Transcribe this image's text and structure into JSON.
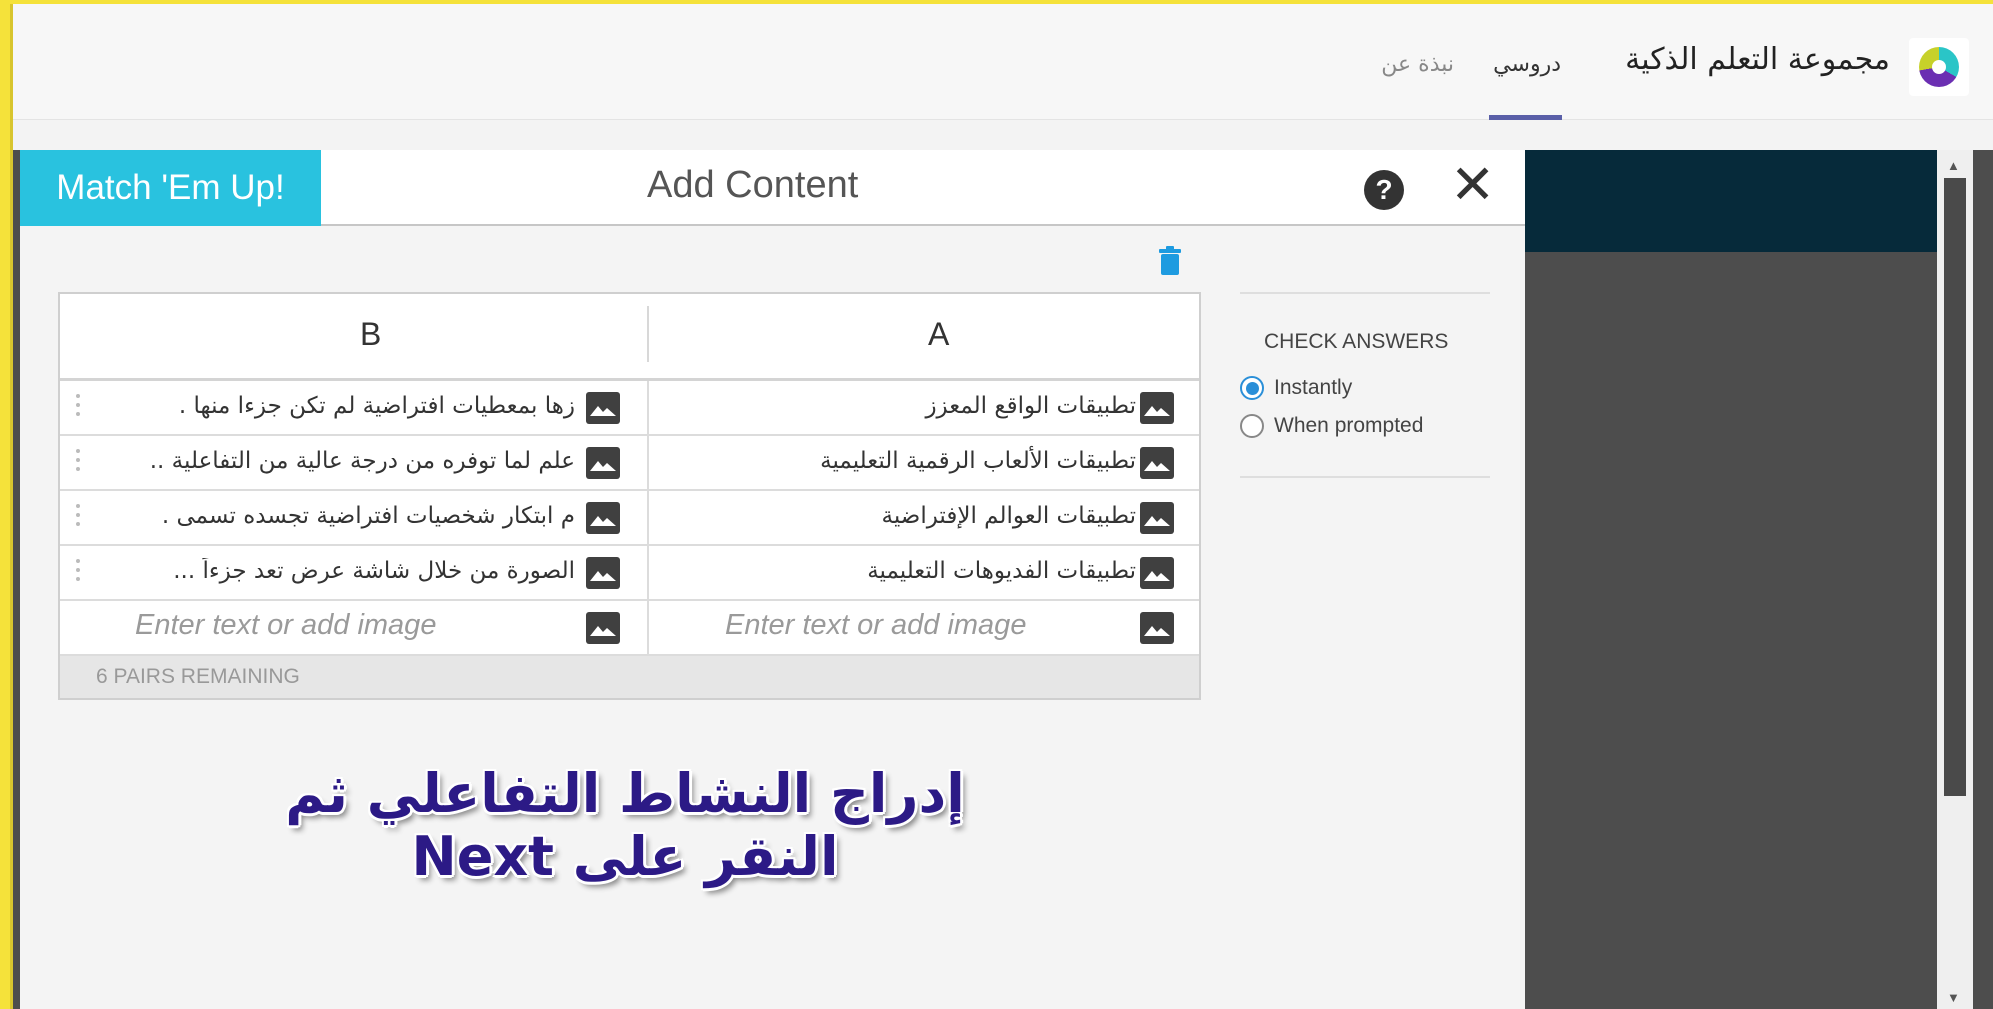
{
  "header": {
    "app_title": "مجموعة التعلم الذكية",
    "tabs": [
      {
        "label": "دروسي",
        "active": true
      },
      {
        "label": "نبذة عن",
        "active": false
      }
    ],
    "logo_icon": "app-logo-icon"
  },
  "modal": {
    "app_badge": "Match 'Em Up!",
    "title": "Add Content",
    "help_icon_glyph": "?",
    "close_icon_glyph": "✕"
  },
  "table": {
    "columns": {
      "b": "B",
      "a": "A"
    },
    "rows": [
      {
        "b": "زها بمعطيات افتراضية لم تكن جزءا منها .",
        "a": "تطبيقات الواقع المعزز"
      },
      {
        "b": "علم لما توفره من درجة عالية من التفاعلية ..",
        "a": "تطبيقات الألعاب الرقمية التعليمية"
      },
      {
        "b": "م ابتكار شخصيات افتراضية تجسده تسمى .",
        "a": "تطبيقات العوالم الإفتراضية"
      },
      {
        "b": "الصورة من خلال شاشة عرض تعد جزءاً ...",
        "a": "تطبيقات الفديوهات التعليمية"
      }
    ],
    "new_row_placeholder_b": "Enter text or add image",
    "new_row_placeholder_a": "Enter text or add image",
    "pairs_remaining": "6 PAIRS REMAINING"
  },
  "check_answers": {
    "title": "CHECK ANSWERS",
    "options": [
      {
        "label": "Instantly",
        "selected": true
      },
      {
        "label": "When prompted",
        "selected": false
      }
    ]
  },
  "caption": "إدراج النشاط التفاعلي ثم النقر على Next",
  "colors": {
    "frame": "#f5e23a",
    "badge": "#29c2df",
    "tab_underline": "#5a5fa8",
    "radio_accent": "#2a8fd8",
    "caption": "#2c1a86",
    "trash": "#1e9be0"
  },
  "scroll": {
    "up_glyph": "▲",
    "down_glyph": "▼"
  }
}
